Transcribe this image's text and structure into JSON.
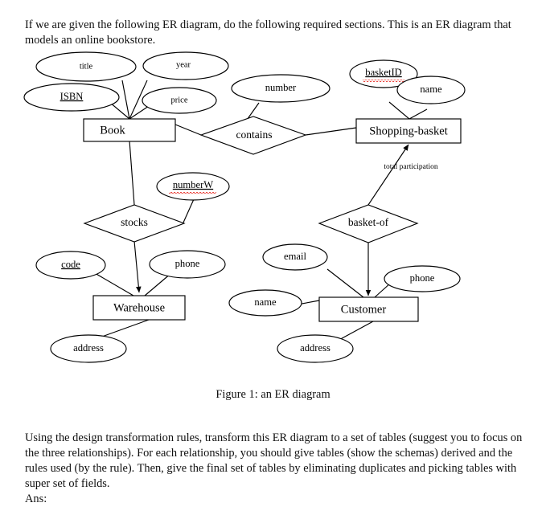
{
  "document": {
    "intro_paragraph": "If we are given the following ER diagram, do the following required sections.  This is an ER diagram that models an online bookstore.",
    "figure_caption": "Figure 1: an ER diagram",
    "closing_paragraph": "Using the design transformation rules, transform this ER diagram to a set of tables (suggest you to focus on the three relationships).  For each relationship, you should give tables (show the schemas) derived and the rules used (by the rule).  Then, give the final set of tables by eliminating duplicates and picking tables with super set of fields.",
    "answer_label": "Ans:"
  },
  "diagram": {
    "entities": [
      {
        "id": "book",
        "label": "Book"
      },
      {
        "id": "shopping_basket",
        "label": "Shopping-basket"
      },
      {
        "id": "warehouse",
        "label": "Warehouse"
      },
      {
        "id": "customer",
        "label": "Customer"
      }
    ],
    "relationships": [
      {
        "id": "contains",
        "label": "contains"
      },
      {
        "id": "stocks",
        "label": "stocks"
      },
      {
        "id": "basket_of",
        "label": "basket-of"
      }
    ],
    "attributes": [
      {
        "id": "book_title",
        "label": "title",
        "key": false,
        "owner": "book"
      },
      {
        "id": "book_isbn",
        "label": "ISBN",
        "key": true,
        "owner": "book"
      },
      {
        "id": "book_year",
        "label": "year",
        "key": false,
        "owner": "book"
      },
      {
        "id": "book_price",
        "label": "price",
        "key": false,
        "owner": "book"
      },
      {
        "id": "contains_number",
        "label": "number",
        "key": false,
        "owner": "contains"
      },
      {
        "id": "basket_id",
        "label": "basketID",
        "key": true,
        "owner": "shopping_basket"
      },
      {
        "id": "basket_name",
        "label": "name",
        "key": false,
        "owner": "shopping_basket"
      },
      {
        "id": "stocks_numberw",
        "label": "numberW",
        "key": true,
        "owner": "stocks"
      },
      {
        "id": "warehouse_code",
        "label": "code",
        "key": true,
        "owner": "warehouse"
      },
      {
        "id": "warehouse_phone",
        "label": "phone",
        "key": false,
        "owner": "warehouse"
      },
      {
        "id": "warehouse_address",
        "label": "address",
        "key": false,
        "owner": "warehouse"
      },
      {
        "id": "customer_email",
        "label": "email",
        "key": false,
        "owner": "customer"
      },
      {
        "id": "customer_phone",
        "label": "phone",
        "key": false,
        "owner": "customer"
      },
      {
        "id": "customer_name",
        "label": "name",
        "key": false,
        "owner": "customer"
      },
      {
        "id": "customer_address",
        "label": "address",
        "key": false,
        "owner": "customer"
      }
    ],
    "edge_labels": [
      {
        "id": "total_participation",
        "label": "total participation"
      }
    ],
    "colors": {
      "stroke": "#000000",
      "fill": "#ffffff",
      "spellcheck_underline": "#e8322a",
      "text": "#000000"
    }
  }
}
